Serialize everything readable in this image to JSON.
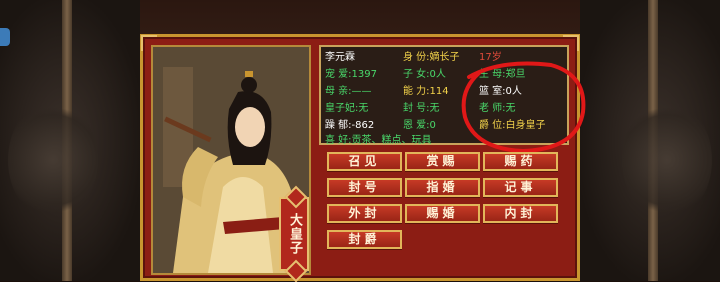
{
  "prince": {
    "name": "李元霖",
    "title_plaque": "大皇子",
    "rows": [
      [
        "李元霖",
        "身 份:嫡长子",
        "17岁"
      ],
      [
        "宠 爱:1397",
        "子 女:0人",
        "生 母:郑旦"
      ],
      [
        "母 亲:——",
        "能 力:114",
        "篮 室:0人"
      ],
      [
        "皇子妃:无",
        "封 号:无",
        "老 师:无"
      ],
      [
        "躁 郁:-862",
        "恩 爱:0",
        "爵 位:白身皇子"
      ]
    ],
    "hobby": "喜 好:贡茶、糕点、玩具"
  },
  "buttons": [
    [
      "召见",
      "赏赐",
      "赐药"
    ],
    [
      "封号",
      "指婚",
      "记事"
    ],
    [
      "外封",
      "赐婚",
      "内封"
    ],
    [
      "封爵"
    ]
  ],
  "colors": {
    "dialog_red": "#8c1d14",
    "gold_border": "#c9952f",
    "label_green": "#49d86a",
    "label_white": "#ffffff",
    "label_yellow": "#f2d24a",
    "annotation_red": "#e01818"
  }
}
